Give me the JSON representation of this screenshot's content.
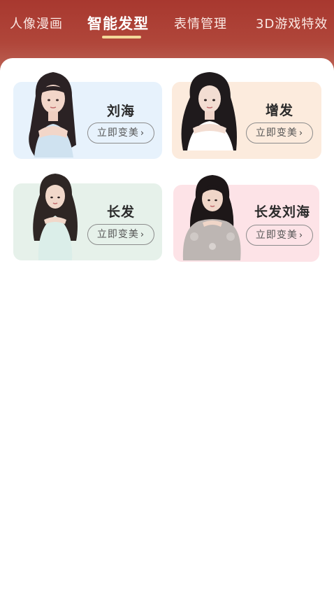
{
  "tabs": [
    {
      "label": "人像漫画",
      "active": false
    },
    {
      "label": "智能发型",
      "active": true
    },
    {
      "label": "表情管理",
      "active": false
    },
    {
      "label": "3D游戏特效",
      "active": false
    }
  ],
  "cards": [
    {
      "title": "刘海",
      "button": "立即变美"
    },
    {
      "title": "增发",
      "button": "立即变美"
    },
    {
      "title": "长发",
      "button": "立即变美"
    },
    {
      "title": "长发刘海",
      "button": "立即变美"
    }
  ],
  "icons": {
    "chevron": "chevron-right-icon"
  },
  "colors": {
    "header": "#a8382f",
    "indicator": "#f3d79a",
    "card_blue": "#e7f2fc",
    "card_peach": "#fcebdd",
    "card_green": "#e6f1ea",
    "card_pink": "#fde3e7"
  }
}
